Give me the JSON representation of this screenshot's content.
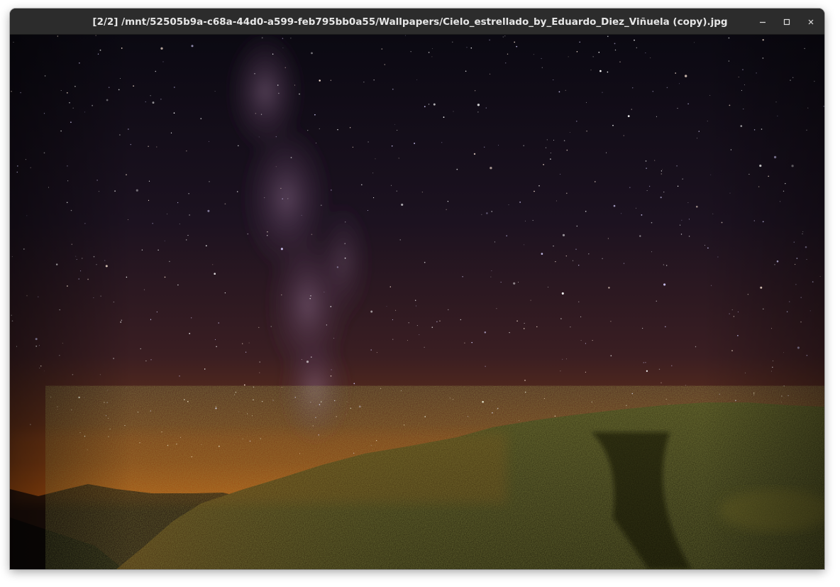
{
  "window": {
    "title": "[2/2] /mnt/52505b9a-c68a-44d0-a599-feb795bb0a55/Wallpapers/Cielo_estrellado_by_Eduardo_Diez_Viñuela (copy).jpg",
    "controls": {
      "minimize_icon": "minimize-icon",
      "maximize_icon": "maximize-icon",
      "close_icon": "close-icon"
    }
  },
  "image": {
    "subject": "starry night sky with milky way over hills",
    "colors": {
      "sky_top": "#0d0a14",
      "sky_mid": "#2a1a2a",
      "sky_horizon": "#b8560e",
      "milky_way": "#6b4a6a",
      "hill_dark": "#1b1a10",
      "hill_lit": "#4a4a1a",
      "mountain_far": "#2a1510"
    }
  }
}
